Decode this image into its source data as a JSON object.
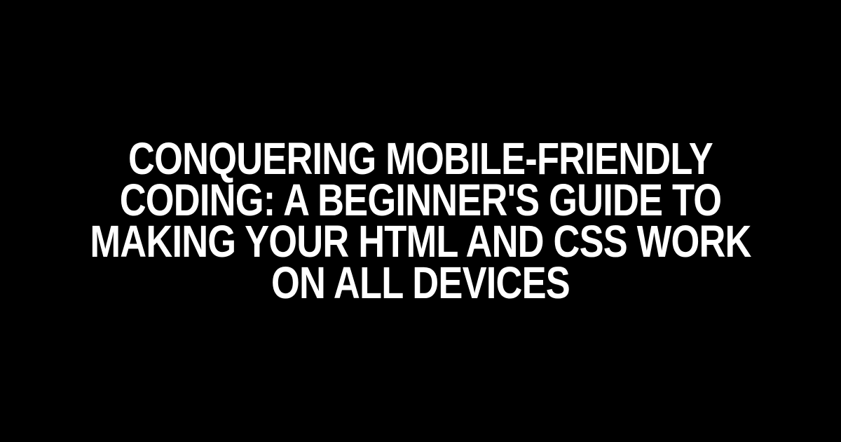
{
  "title": "Conquering Mobile-Friendly Coding: A Beginner's Guide to Making Your HTML and CSS Work on All Devices"
}
